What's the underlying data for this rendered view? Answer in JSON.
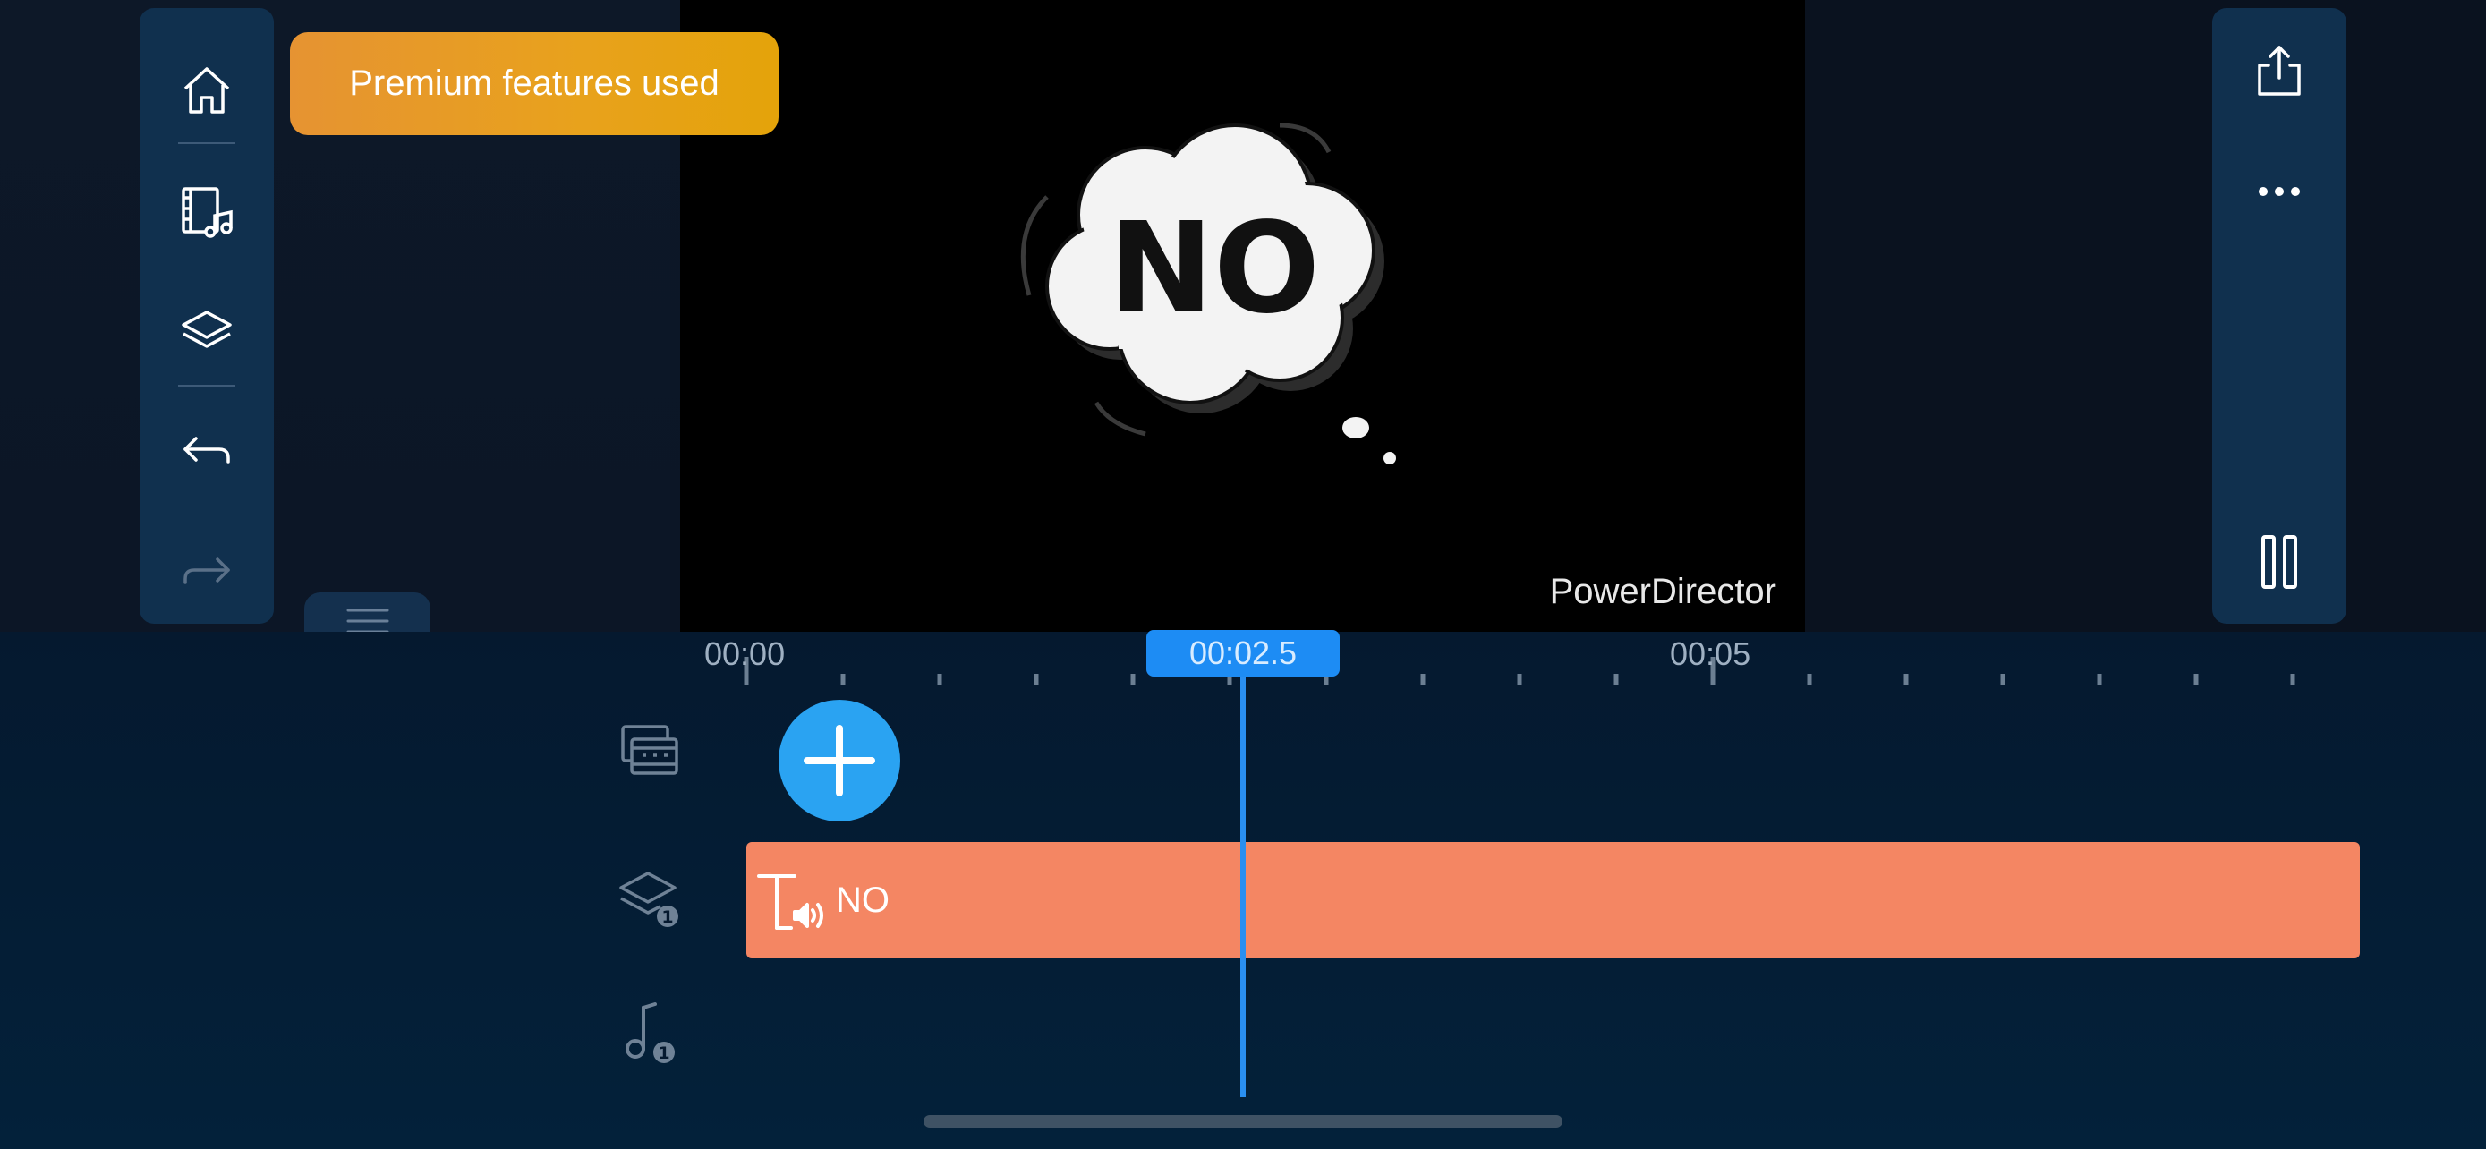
{
  "badge": {
    "premium_label": "Premium features used"
  },
  "preview": {
    "watermark": "PowerDirector",
    "title_text": "NO"
  },
  "left_toolbar": {
    "icons": [
      "home-icon",
      "media-library-icon",
      "layers-icon",
      "undo-icon",
      "redo-icon"
    ]
  },
  "right_toolbar": {
    "icons": [
      "export-icon",
      "more-icon",
      "pause-icon"
    ]
  },
  "timeline": {
    "ruler_labels": [
      "00:00",
      "00:05"
    ],
    "playhead_time": "00:02.5",
    "tracks": [
      {
        "type": "video",
        "icon": "video-track-icon",
        "badge": ""
      },
      {
        "type": "overlay",
        "icon": "layers-track-icon",
        "badge": "1"
      },
      {
        "type": "audio",
        "icon": "music-track-icon",
        "badge": "1"
      }
    ],
    "title_clip_label": "NO"
  },
  "colors": {
    "accent": "#1d8cf4",
    "clip": "#f48663",
    "badge_orange": "#e69332",
    "toolbar": "#10304e"
  }
}
